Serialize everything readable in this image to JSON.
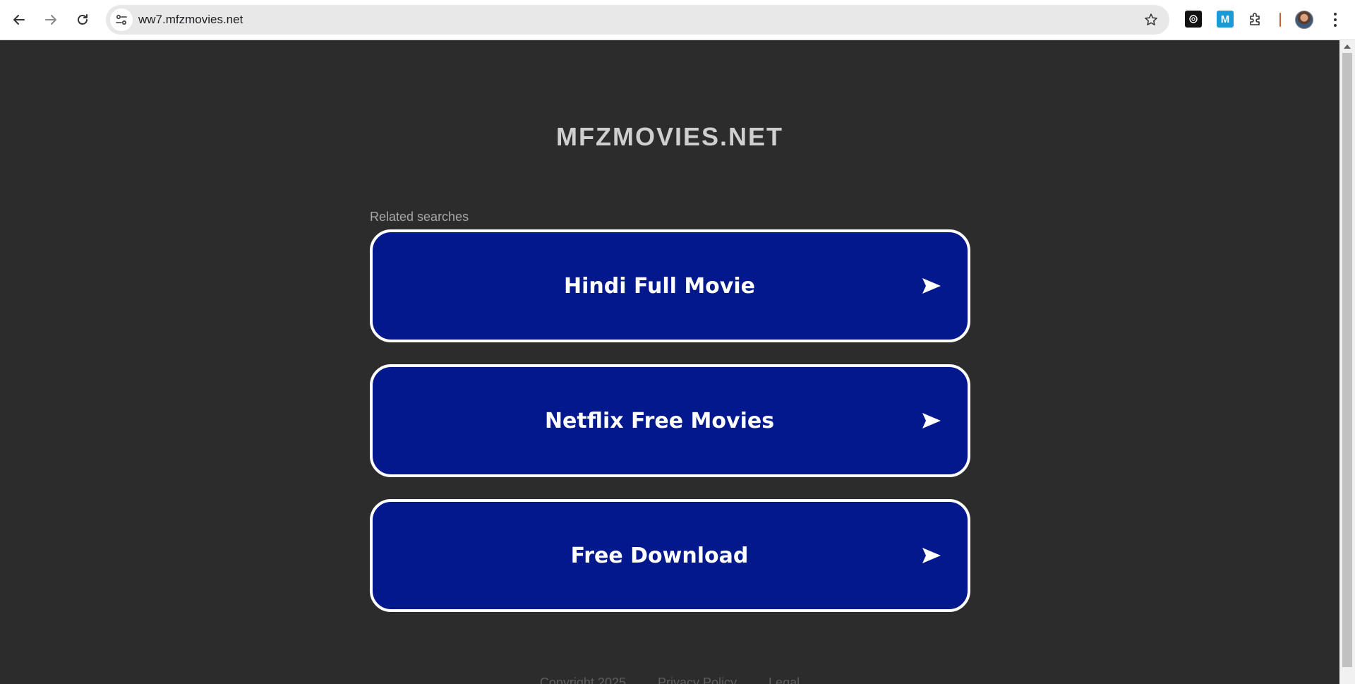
{
  "browser": {
    "url": "ww7.mfzmovies.net"
  },
  "page": {
    "site_title": "MFZMOVIES.NET",
    "related_label": "Related searches",
    "searches": [
      {
        "label": "Hindi Full Movie"
      },
      {
        "label": "Netflix Free Movies"
      },
      {
        "label": "Free Download"
      }
    ],
    "footer": {
      "copyright": "Copyright 2025",
      "privacy": "Privacy Policy",
      "legal": "Legal"
    }
  },
  "colors": {
    "page_bg": "#2c2c2c",
    "button_bg": "#03188c",
    "button_border": "#ffffff",
    "title": "#cfcfcf"
  },
  "extensions": {
    "ext2_letter": "M"
  }
}
